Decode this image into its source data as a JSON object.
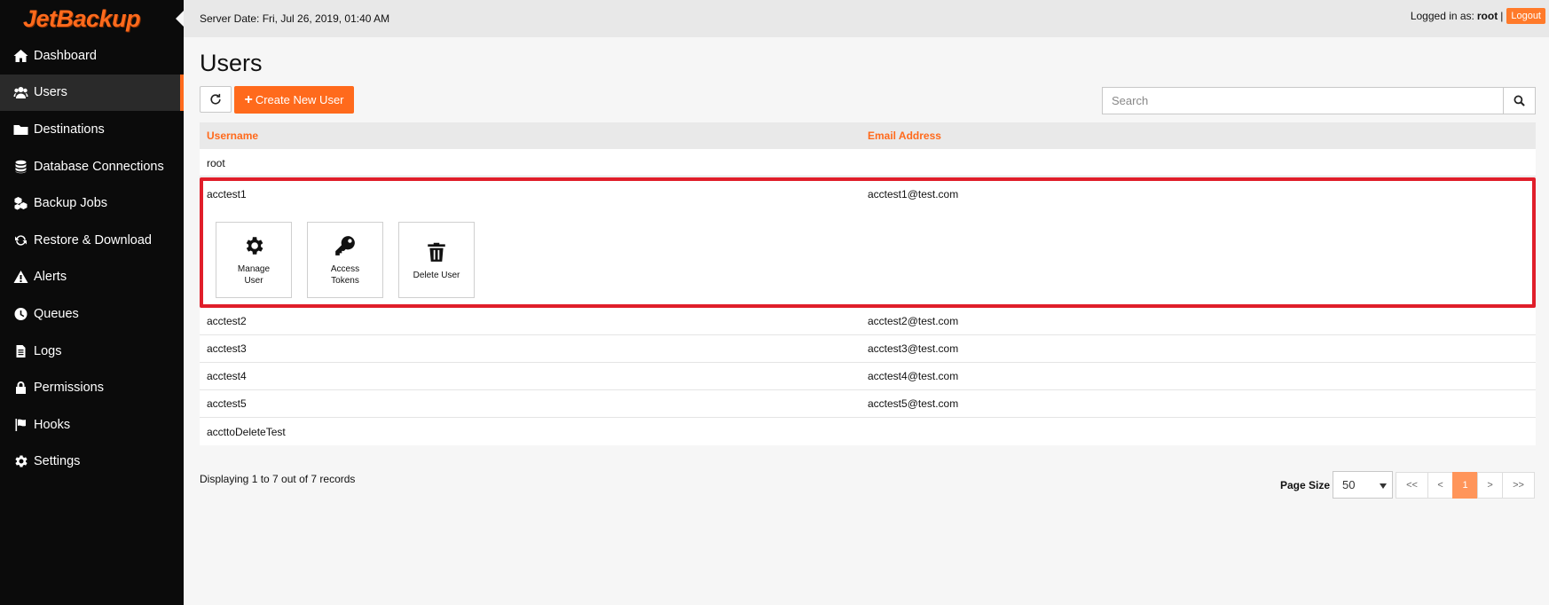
{
  "app": {
    "logo_text": "JetBackup"
  },
  "colors": {
    "accent": "#ff6a1c",
    "sidebar_bg": "#0b0b0b",
    "highlight_border": "#e01e2a"
  },
  "sidebar": {
    "items": [
      {
        "label": "Dashboard",
        "icon": "home-icon"
      },
      {
        "label": "Users",
        "icon": "users-icon",
        "active": true
      },
      {
        "label": "Destinations",
        "icon": "folder-icon"
      },
      {
        "label": "Database Connections",
        "icon": "database-icon"
      },
      {
        "label": "Backup Jobs",
        "icon": "cubes-icon"
      },
      {
        "label": "Restore & Download",
        "icon": "sync-icon"
      },
      {
        "label": "Alerts",
        "icon": "warning-icon"
      },
      {
        "label": "Queues",
        "icon": "clock-icon"
      },
      {
        "label": "Logs",
        "icon": "file-icon"
      },
      {
        "label": "Permissions",
        "icon": "lock-icon"
      },
      {
        "label": "Hooks",
        "icon": "flag-icon"
      },
      {
        "label": "Settings",
        "icon": "gear-icon"
      }
    ]
  },
  "header": {
    "server_date": "Server Date: Fri, Jul 26, 2019, 01:40 AM",
    "logged_in_prefix": "Logged in as:",
    "username": "root",
    "separator": "|",
    "logout_label": "Logout"
  },
  "main": {
    "title": "Users",
    "create_label": "Create New User",
    "search_placeholder": "Search",
    "columns": {
      "username": "Username",
      "email": "Email Address"
    },
    "rows_before": [
      {
        "username": "root",
        "email": ""
      }
    ],
    "expanded_row": {
      "username": "acctest1",
      "email": "acctest1@test.com",
      "actions": [
        {
          "label": "Manage User",
          "icon": "gear-icon"
        },
        {
          "label": "Access Tokens",
          "icon": "key-icon"
        },
        {
          "label": "Delete User",
          "icon": "trash-icon"
        }
      ]
    },
    "rows_after": [
      {
        "username": "acctest2",
        "email": "acctest2@test.com"
      },
      {
        "username": "acctest3",
        "email": "acctest3@test.com"
      },
      {
        "username": "acctest4",
        "email": "acctest4@test.com"
      },
      {
        "username": "acctest5",
        "email": "acctest5@test.com"
      },
      {
        "username": "accttoDeleteTest",
        "email": ""
      }
    ]
  },
  "footer": {
    "records_text": "Displaying 1 to 7 out of 7 records",
    "page_size_label": "Page Size",
    "page_size_value": "50",
    "pager": {
      "first": "<<",
      "prev": "<",
      "current": "1",
      "next": ">",
      "last": ">>"
    }
  }
}
